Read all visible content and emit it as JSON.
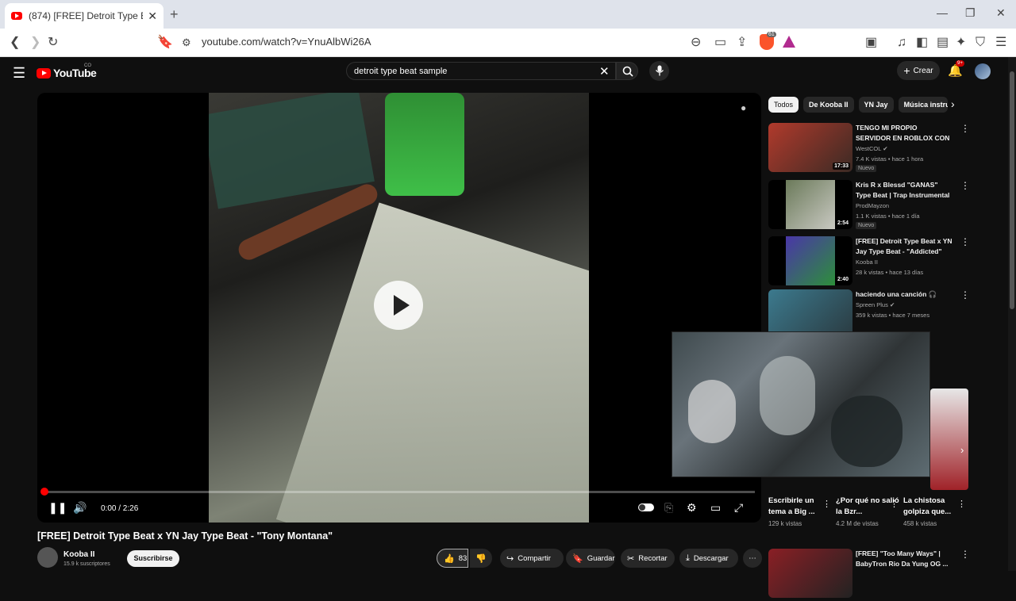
{
  "browser": {
    "tab_title": "(874) [FREE] Detroit Type Beat x",
    "url": "youtube.com/watch?v=YnuAlbWi26A",
    "brave_badge": "61"
  },
  "header": {
    "logo": "YouTube",
    "country": "CO",
    "search_query": "detroit type beat sample",
    "create_label": "Crear",
    "notif_badge": "9+"
  },
  "player": {
    "time": "0:00 / 2:26",
    "progress": 0.0
  },
  "video": {
    "title": "[FREE] Detroit Type Beat x YN Jay Type Beat - \"Tony Montana\"",
    "channel": "Kooba II",
    "subscribers": "15.9 k suscriptores",
    "subscribe_label": "Suscribirse",
    "likes": "83",
    "share_label": "Compartir",
    "save_label": "Guardar",
    "clip_label": "Recortar",
    "download_label": "Descargar"
  },
  "sidebar": {
    "chips": [
      "Todos",
      "De Kooba II",
      "YN Jay",
      "Música instru"
    ],
    "recommendations": [
      {
        "title": "TENGO MI PROPIO SERVIDOR EN ROBLOX CON MIS ...",
        "channel": "WestCOL",
        "meta": "7.4 K vistas • hace 1 hora",
        "badge": "Nuevo",
        "duration": "17:33",
        "color": "#b13a2c"
      },
      {
        "title": "Kris R x Blessd \"GANAS\" Type Beat | Trap Instrumental ...",
        "channel": "ProdMayzon",
        "meta": "1.1 K vistas • hace 1 día",
        "badge": "Nuevo",
        "duration": "2:54",
        "color": "#6b7a5a"
      },
      {
        "title": "[FREE] Detroit Type Beat x YN Jay Type Beat - \"Addicted\"",
        "channel": "Kooba II",
        "meta": "28 k vistas • hace 13 días",
        "badge": "",
        "duration": "2:40",
        "color": "#4a36a8"
      },
      {
        "title": "haciendo una canción 🎧",
        "channel": "Spreen Plus",
        "meta": "359 k vistas • hace 7 meses",
        "badge": "",
        "duration": "",
        "color": "#3c7a8e"
      }
    ],
    "shorts": [
      {
        "title": "Escribirle un tema a Big ...",
        "views": "129 k vistas"
      },
      {
        "title": "¿Por qué no salió la Bzr...",
        "views": "4.2 M de vistas"
      },
      {
        "title": "La chistosa golpiza que...",
        "views": "458 k vistas"
      }
    ],
    "last_rec": {
      "title": "[FREE] \"Too Many Ways\" | BabyTron Rio Da Yung OG ..."
    }
  }
}
